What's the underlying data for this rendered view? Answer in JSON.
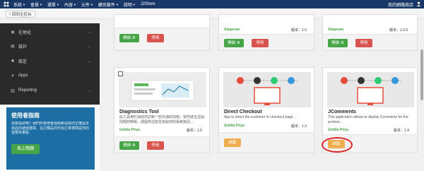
{
  "topbar": {
    "menu": [
      {
        "label": "系統"
      },
      {
        "label": "會員"
      },
      {
        "label": "選單"
      },
      {
        "label": "內容"
      },
      {
        "label": "元件"
      },
      {
        "label": "擴充套件"
      },
      {
        "label": "說明"
      },
      {
        "label": "J2Store"
      }
    ],
    "site_name": "我的網路商店"
  },
  "toolbar": {
    "back_label": "回到主控台"
  },
  "sidebar": {
    "items": [
      {
        "label": "在地化",
        "icon": "globe-icon"
      },
      {
        "label": "設計",
        "icon": "design-icon"
      },
      {
        "label": "設定",
        "icon": "settings-icon"
      },
      {
        "label": "Apps",
        "icon": "apps-icon"
      },
      {
        "label": "Reporting",
        "icon": "reporting-icon"
      }
    ],
    "guide": {
      "title": "使用者指南",
      "text": "需要協助嗎？我們的使用者指南將協助你正確設定商店的總值選擇，在訂購區的所有訂單選擇是你的首要考量點",
      "button": "馬上閱讀"
    }
  },
  "cards": {
    "c1": {
      "open": "開啟",
      "disable": "停用"
    },
    "c2": {
      "author": "Alagesan",
      "version": "版本：1.0",
      "open": "開啟",
      "disable": "停用"
    },
    "c3": {
      "author": "Alagesan",
      "version": "版本：1.0.0",
      "open": "開啟",
      "disable": "停用"
    },
    "c4": {
      "title": "Diagnostics Tool",
      "desc": "此工具用於協助你診斷一些共通的問題，當你發生這個問題的時候，請提供這些信息給你的系統資訊...",
      "author": "Gokila Priya",
      "version": "版本：1.0",
      "open": "開啟",
      "disable": "停用"
    },
    "c5": {
      "title": "Direct Checkout",
      "desc": "App to direct the customer to checkout page ...",
      "author": "Gokila Priya",
      "version": "版本：1.3",
      "enable": "啟動"
    },
    "c6": {
      "title": "JComments",
      "desc": "This application allows to display Comments for the product...",
      "author": "Gokila Priya",
      "version": "版本：1.4",
      "enable": "啟動"
    }
  },
  "colors": {
    "topbar": "#1a3867",
    "sidebar_nav": "#2a2a2a",
    "guide": "#1c6ea4",
    "green": "#46a546",
    "red": "#d9534f",
    "orange": "#f0ad4e",
    "highlight": "#e02020"
  }
}
